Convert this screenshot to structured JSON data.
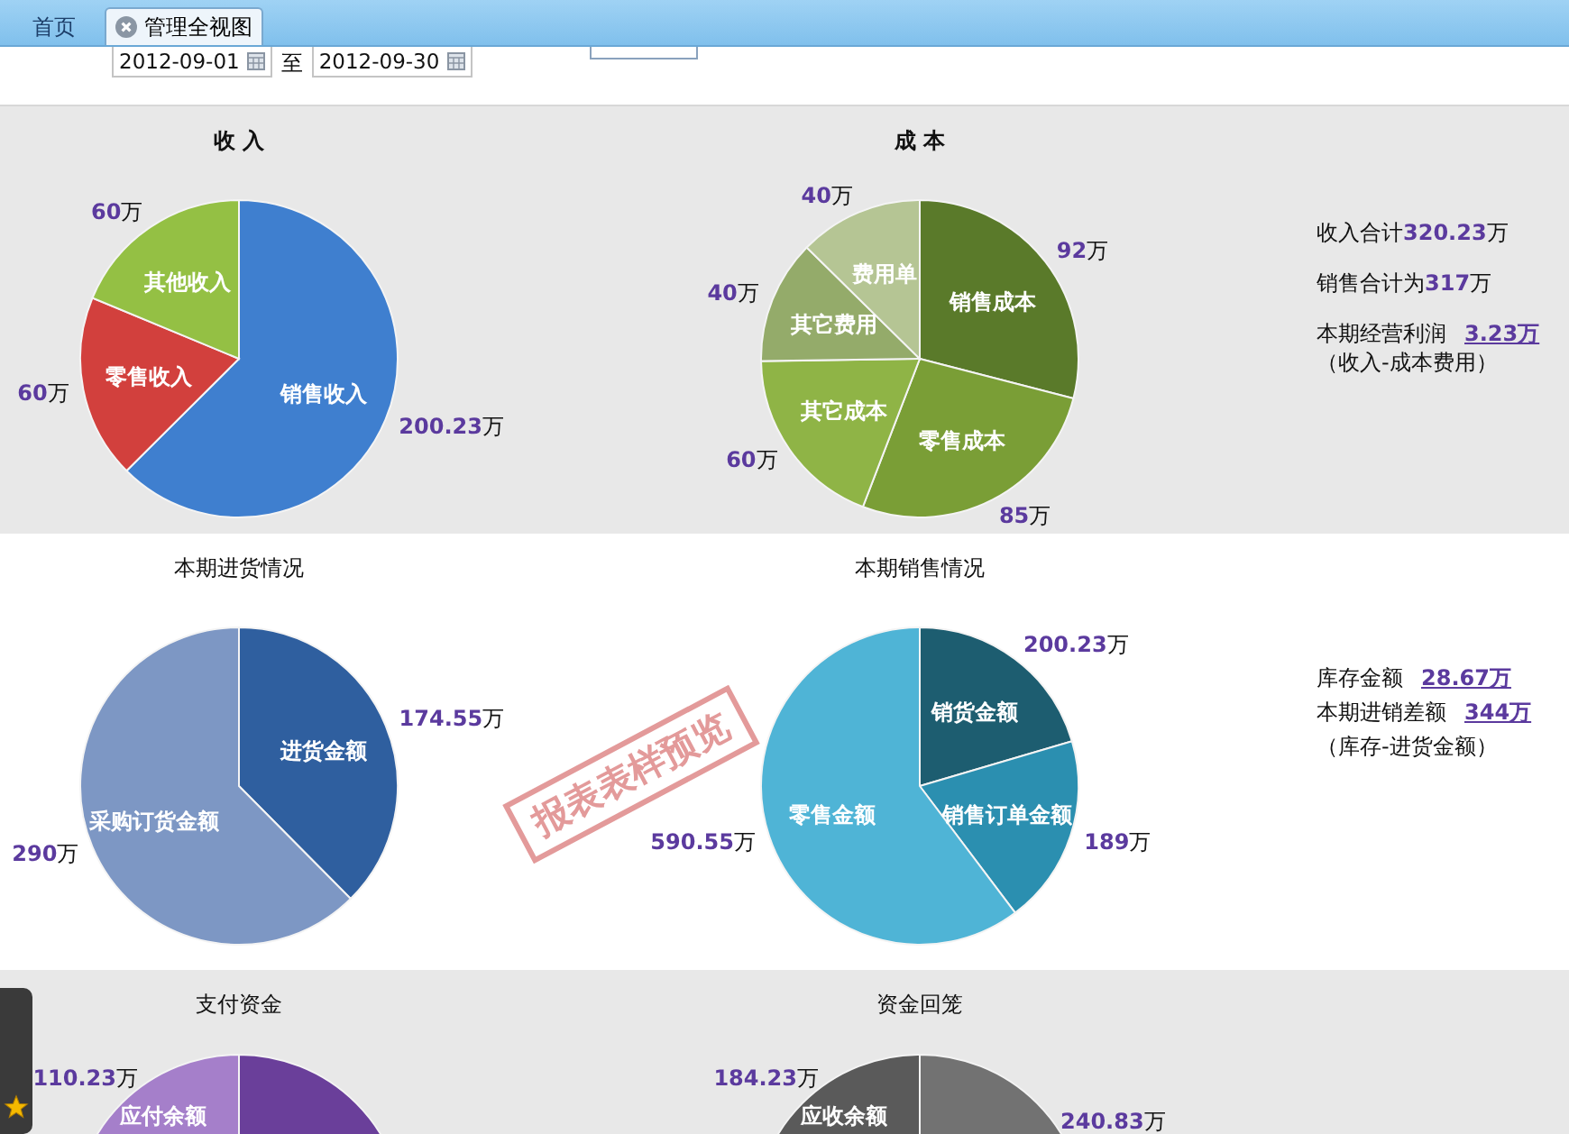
{
  "tabs": [
    {
      "label": "首页",
      "selected": false,
      "closable": false
    },
    {
      "label": "管理全视图",
      "selected": true,
      "closable": true
    }
  ],
  "toolbar": {
    "date_from": "2012-09-01",
    "separator": "至",
    "date_to": "2012-09-30"
  },
  "sections": [
    {
      "charts": [
        {
          "kind": "chart",
          "chart_data": {
            "type": "pie",
            "title": "收 入",
            "categories": [
              "销售收入",
              "零售收入",
              "其他收入"
            ],
            "values": [
              200.23,
              60,
              60
            ],
            "value_labels": [
              "200.23万",
              "60万",
              "60万"
            ],
            "colors": [
              "#3f7fcf",
              "#d2403d",
              "#94c044"
            ]
          }
        },
        {
          "kind": "chart",
          "chart_data": {
            "type": "pie",
            "title": "成 本",
            "categories": [
              "销售成本",
              "零售成本",
              "其它成本",
              "其它费用",
              "费用单"
            ],
            "values": [
              92,
              85,
              60,
              40,
              40
            ],
            "value_labels": [
              "92万",
              "85万",
              "60万",
              "40万",
              "40万"
            ],
            "colors": [
              "#5a7a2a",
              "#7a9e36",
              "#8fb446",
              "#94ab6a",
              "#b5c594"
            ]
          }
        }
      ],
      "summary": [
        {
          "kind": "text",
          "text": "收入合计**320.23**万"
        },
        {
          "kind": "text",
          "text": "销售合计为**317**万"
        },
        {
          "kind": "link",
          "label": "本期经营利润",
          "link": "3.23万"
        },
        {
          "kind": "text",
          "text": "（收入-成本费用）"
        }
      ]
    },
    {
      "charts": [
        {
          "kind": "chart",
          "chart_data": {
            "type": "pie",
            "title": "本期进货情况",
            "categories": [
              "进货金额",
              "采购订货金额"
            ],
            "values": [
              174.55,
              290
            ],
            "value_labels": [
              "174.55万",
              "290万"
            ],
            "colors": [
              "#2f5f9f",
              "#7d97c4"
            ]
          }
        },
        {
          "kind": "chart",
          "chart_data": {
            "type": "pie",
            "title": "本期销售情况",
            "categories": [
              "销货金额",
              "销售订单金额",
              "零售金额"
            ],
            "values": [
              200.23,
              189,
              590.55
            ],
            "value_labels": [
              "200.23万",
              "189万",
              "590.55万"
            ],
            "colors": [
              "#1d5d70",
              "#2b8fb0",
              "#4fb4d6"
            ]
          }
        }
      ],
      "summary": [
        {
          "kind": "link",
          "label": "库存金额",
          "link": "28.67万"
        },
        {
          "kind": "link",
          "label": "本期进销差额",
          "link": "344万"
        },
        {
          "kind": "text",
          "text": "（库存-进货金额）"
        }
      ],
      "stamp": "报表表样预览"
    },
    {
      "charts": [
        {
          "kind": "cut_pie",
          "title": "支付资金",
          "left_label": "110.23万",
          "slice_label": "应付余额",
          "slices": [
            {
              "color": "#a57fca"
            },
            {
              "color": "#6a3f9a"
            }
          ]
        },
        {
          "kind": "cut_pie",
          "title": "资金回笼",
          "left_label": "184.23万",
          "right_label": "240.83万",
          "slice_label": "应收余额",
          "slices": [
            {
              "color": "#5a5a5a"
            },
            {
              "color": "#727272"
            }
          ]
        }
      ]
    }
  ]
}
